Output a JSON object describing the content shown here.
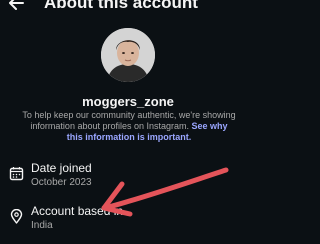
{
  "header": {
    "title": "About this account",
    "back_icon": "arrow-left-icon"
  },
  "profile": {
    "username": "moggers_zone",
    "avatar_icon": "profile-avatar"
  },
  "info": {
    "text": "To help keep our community authentic, we're showing information about profiles on Instagram.",
    "link_label": "See why this information is important."
  },
  "details": {
    "date_joined": {
      "label": "Date joined",
      "value": "October 2023",
      "icon": "calendar-icon"
    },
    "account_based": {
      "label": "Account based in",
      "value": "India",
      "icon": "location-pin-icon"
    }
  },
  "annotation": {
    "color": "#e4545a"
  },
  "colors": {
    "background": "#0b1014",
    "text_primary": "#f5f5f5",
    "text_secondary": "#a8a8a8",
    "link": "#9aa6ff"
  }
}
